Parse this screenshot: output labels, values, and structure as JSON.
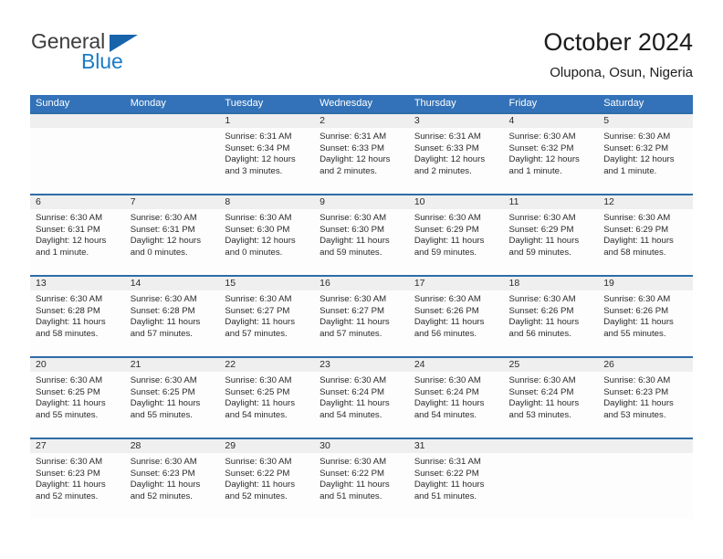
{
  "brand": {
    "name_part1": "General",
    "name_part2": "Blue",
    "triangle_icon": "blue-triangle-logo-mark",
    "color_primary": "#1764ab",
    "color_text": "#3d3d3d"
  },
  "header": {
    "title": "October 2024",
    "subtitle": "Olupona, Osun, Nigeria"
  },
  "theme": {
    "header_bar_bg": "#3372b8",
    "week_separator": "#2e6da8",
    "date_band_bg": "#efefef",
    "cell_bg": "#fdfdfd",
    "text": "#2b2b2b"
  },
  "weekdays": [
    "Sunday",
    "Monday",
    "Tuesday",
    "Wednesday",
    "Thursday",
    "Friday",
    "Saturday"
  ],
  "weeks": [
    {
      "days": [
        {
          "num": "",
          "sunrise": "",
          "sunset": "",
          "daylight1": "",
          "daylight2": "",
          "empty": true
        },
        {
          "num": "",
          "sunrise": "",
          "sunset": "",
          "daylight1": "",
          "daylight2": "",
          "empty": true
        },
        {
          "num": "1",
          "sunrise": "Sunrise: 6:31 AM",
          "sunset": "Sunset: 6:34 PM",
          "daylight1": "Daylight: 12 hours",
          "daylight2": "and 3 minutes.",
          "empty": false
        },
        {
          "num": "2",
          "sunrise": "Sunrise: 6:31 AM",
          "sunset": "Sunset: 6:33 PM",
          "daylight1": "Daylight: 12 hours",
          "daylight2": "and 2 minutes.",
          "empty": false
        },
        {
          "num": "3",
          "sunrise": "Sunrise: 6:31 AM",
          "sunset": "Sunset: 6:33 PM",
          "daylight1": "Daylight: 12 hours",
          "daylight2": "and 2 minutes.",
          "empty": false
        },
        {
          "num": "4",
          "sunrise": "Sunrise: 6:30 AM",
          "sunset": "Sunset: 6:32 PM",
          "daylight1": "Daylight: 12 hours",
          "daylight2": "and 1 minute.",
          "empty": false
        },
        {
          "num": "5",
          "sunrise": "Sunrise: 6:30 AM",
          "sunset": "Sunset: 6:32 PM",
          "daylight1": "Daylight: 12 hours",
          "daylight2": "and 1 minute.",
          "empty": false
        }
      ]
    },
    {
      "days": [
        {
          "num": "6",
          "sunrise": "Sunrise: 6:30 AM",
          "sunset": "Sunset: 6:31 PM",
          "daylight1": "Daylight: 12 hours",
          "daylight2": "and 1 minute.",
          "empty": false
        },
        {
          "num": "7",
          "sunrise": "Sunrise: 6:30 AM",
          "sunset": "Sunset: 6:31 PM",
          "daylight1": "Daylight: 12 hours",
          "daylight2": "and 0 minutes.",
          "empty": false
        },
        {
          "num": "8",
          "sunrise": "Sunrise: 6:30 AM",
          "sunset": "Sunset: 6:30 PM",
          "daylight1": "Daylight: 12 hours",
          "daylight2": "and 0 minutes.",
          "empty": false
        },
        {
          "num": "9",
          "sunrise": "Sunrise: 6:30 AM",
          "sunset": "Sunset: 6:30 PM",
          "daylight1": "Daylight: 11 hours",
          "daylight2": "and 59 minutes.",
          "empty": false
        },
        {
          "num": "10",
          "sunrise": "Sunrise: 6:30 AM",
          "sunset": "Sunset: 6:29 PM",
          "daylight1": "Daylight: 11 hours",
          "daylight2": "and 59 minutes.",
          "empty": false
        },
        {
          "num": "11",
          "sunrise": "Sunrise: 6:30 AM",
          "sunset": "Sunset: 6:29 PM",
          "daylight1": "Daylight: 11 hours",
          "daylight2": "and 59 minutes.",
          "empty": false
        },
        {
          "num": "12",
          "sunrise": "Sunrise: 6:30 AM",
          "sunset": "Sunset: 6:29 PM",
          "daylight1": "Daylight: 11 hours",
          "daylight2": "and 58 minutes.",
          "empty": false
        }
      ]
    },
    {
      "days": [
        {
          "num": "13",
          "sunrise": "Sunrise: 6:30 AM",
          "sunset": "Sunset: 6:28 PM",
          "daylight1": "Daylight: 11 hours",
          "daylight2": "and 58 minutes.",
          "empty": false
        },
        {
          "num": "14",
          "sunrise": "Sunrise: 6:30 AM",
          "sunset": "Sunset: 6:28 PM",
          "daylight1": "Daylight: 11 hours",
          "daylight2": "and 57 minutes.",
          "empty": false
        },
        {
          "num": "15",
          "sunrise": "Sunrise: 6:30 AM",
          "sunset": "Sunset: 6:27 PM",
          "daylight1": "Daylight: 11 hours",
          "daylight2": "and 57 minutes.",
          "empty": false
        },
        {
          "num": "16",
          "sunrise": "Sunrise: 6:30 AM",
          "sunset": "Sunset: 6:27 PM",
          "daylight1": "Daylight: 11 hours",
          "daylight2": "and 57 minutes.",
          "empty": false
        },
        {
          "num": "17",
          "sunrise": "Sunrise: 6:30 AM",
          "sunset": "Sunset: 6:26 PM",
          "daylight1": "Daylight: 11 hours",
          "daylight2": "and 56 minutes.",
          "empty": false
        },
        {
          "num": "18",
          "sunrise": "Sunrise: 6:30 AM",
          "sunset": "Sunset: 6:26 PM",
          "daylight1": "Daylight: 11 hours",
          "daylight2": "and 56 minutes.",
          "empty": false
        },
        {
          "num": "19",
          "sunrise": "Sunrise: 6:30 AM",
          "sunset": "Sunset: 6:26 PM",
          "daylight1": "Daylight: 11 hours",
          "daylight2": "and 55 minutes.",
          "empty": false
        }
      ]
    },
    {
      "days": [
        {
          "num": "20",
          "sunrise": "Sunrise: 6:30 AM",
          "sunset": "Sunset: 6:25 PM",
          "daylight1": "Daylight: 11 hours",
          "daylight2": "and 55 minutes.",
          "empty": false
        },
        {
          "num": "21",
          "sunrise": "Sunrise: 6:30 AM",
          "sunset": "Sunset: 6:25 PM",
          "daylight1": "Daylight: 11 hours",
          "daylight2": "and 55 minutes.",
          "empty": false
        },
        {
          "num": "22",
          "sunrise": "Sunrise: 6:30 AM",
          "sunset": "Sunset: 6:25 PM",
          "daylight1": "Daylight: 11 hours",
          "daylight2": "and 54 minutes.",
          "empty": false
        },
        {
          "num": "23",
          "sunrise": "Sunrise: 6:30 AM",
          "sunset": "Sunset: 6:24 PM",
          "daylight1": "Daylight: 11 hours",
          "daylight2": "and 54 minutes.",
          "empty": false
        },
        {
          "num": "24",
          "sunrise": "Sunrise: 6:30 AM",
          "sunset": "Sunset: 6:24 PM",
          "daylight1": "Daylight: 11 hours",
          "daylight2": "and 54 minutes.",
          "empty": false
        },
        {
          "num": "25",
          "sunrise": "Sunrise: 6:30 AM",
          "sunset": "Sunset: 6:24 PM",
          "daylight1": "Daylight: 11 hours",
          "daylight2": "and 53 minutes.",
          "empty": false
        },
        {
          "num": "26",
          "sunrise": "Sunrise: 6:30 AM",
          "sunset": "Sunset: 6:23 PM",
          "daylight1": "Daylight: 11 hours",
          "daylight2": "and 53 minutes.",
          "empty": false
        }
      ]
    },
    {
      "days": [
        {
          "num": "27",
          "sunrise": "Sunrise: 6:30 AM",
          "sunset": "Sunset: 6:23 PM",
          "daylight1": "Daylight: 11 hours",
          "daylight2": "and 52 minutes.",
          "empty": false
        },
        {
          "num": "28",
          "sunrise": "Sunrise: 6:30 AM",
          "sunset": "Sunset: 6:23 PM",
          "daylight1": "Daylight: 11 hours",
          "daylight2": "and 52 minutes.",
          "empty": false
        },
        {
          "num": "29",
          "sunrise": "Sunrise: 6:30 AM",
          "sunset": "Sunset: 6:22 PM",
          "daylight1": "Daylight: 11 hours",
          "daylight2": "and 52 minutes.",
          "empty": false
        },
        {
          "num": "30",
          "sunrise": "Sunrise: 6:30 AM",
          "sunset": "Sunset: 6:22 PM",
          "daylight1": "Daylight: 11 hours",
          "daylight2": "and 51 minutes.",
          "empty": false
        },
        {
          "num": "31",
          "sunrise": "Sunrise: 6:31 AM",
          "sunset": "Sunset: 6:22 PM",
          "daylight1": "Daylight: 11 hours",
          "daylight2": "and 51 minutes.",
          "empty": false
        },
        {
          "num": "",
          "sunrise": "",
          "sunset": "",
          "daylight1": "",
          "daylight2": "",
          "empty": true
        },
        {
          "num": "",
          "sunrise": "",
          "sunset": "",
          "daylight1": "",
          "daylight2": "",
          "empty": true
        }
      ]
    }
  ]
}
